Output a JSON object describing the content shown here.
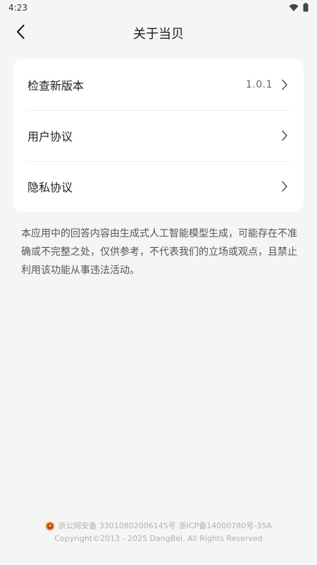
{
  "status_bar": {
    "time": "4:23",
    "icons": [
      "wifi-icon",
      "battery-icon"
    ]
  },
  "header": {
    "title": "关于当贝",
    "back_icon": "chevron-left-icon"
  },
  "settings": {
    "items": [
      {
        "label": "检查新版本",
        "value": "1.0.1"
      },
      {
        "label": "用户协议"
      },
      {
        "label": "隐私协议"
      }
    ]
  },
  "disclaimer": "本应用中的回答内容由生成式人工智能模型生成，可能存在不准确或不完整之处，仅供参考，不代表我们的立场或观点，且禁止利用该功能从事违法活动。",
  "footer": {
    "police_record": "浙公网安备 33010802006145号",
    "icp_record": "浙ICP备14000780号-35A",
    "copyright": "Copyright©2013 - 2025 DangBei. All Rights Reserved"
  },
  "colors": {
    "background": "#f5f5f5",
    "card": "#ffffff",
    "footer_text": "#b0b0b0"
  }
}
